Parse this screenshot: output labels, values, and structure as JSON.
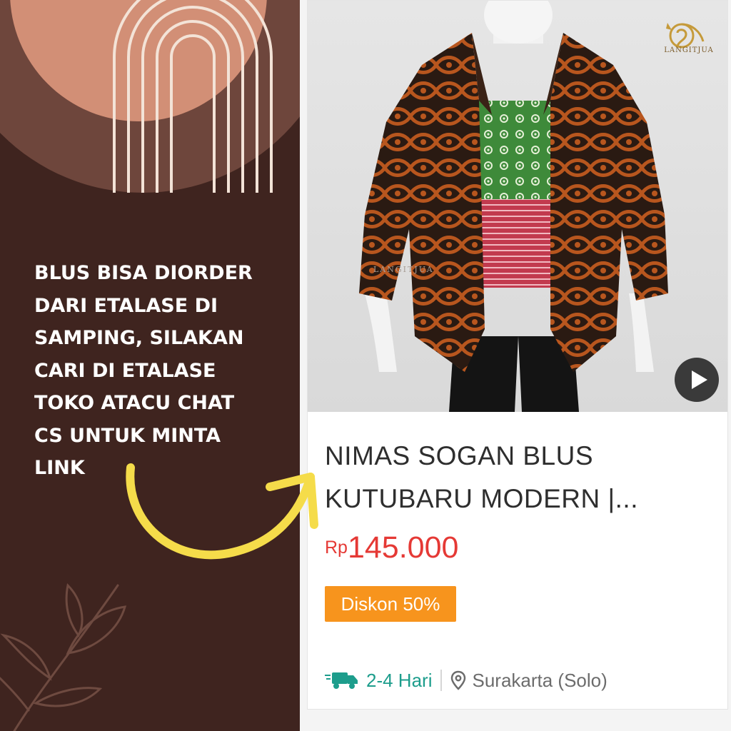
{
  "promo": {
    "lines": [
      "BLUS BISA DIORDER",
      "DARI ETALASE DI",
      "SAMPING, SILAKAN",
      "CARI DI ETALASE",
      "TOKO ATACU CHAT",
      "CS UNTUK MINTA",
      "LINK"
    ]
  },
  "product": {
    "title_line1": "NIMAS SOGAN BLUS",
    "title_line2": "KUTUBARU MODERN |...",
    "currency": "Rp",
    "price": "145.000",
    "discount_badge": "Diskon 50%",
    "delivery_time": "2-4 Hari",
    "location": "Surakarta (Solo)"
  },
  "brand": {
    "name": "LANGITJUA"
  },
  "icons": {
    "play": "play-icon",
    "shipping": "truck-icon",
    "location": "location-pin-icon"
  },
  "colors": {
    "dark_brown": "#3f241f",
    "peach": "#d28f76",
    "price_red": "#e53935",
    "badge_orange": "#f7941d",
    "delivery_teal": "#1d9d8c",
    "arrow_yellow": "#f5dc4a"
  }
}
